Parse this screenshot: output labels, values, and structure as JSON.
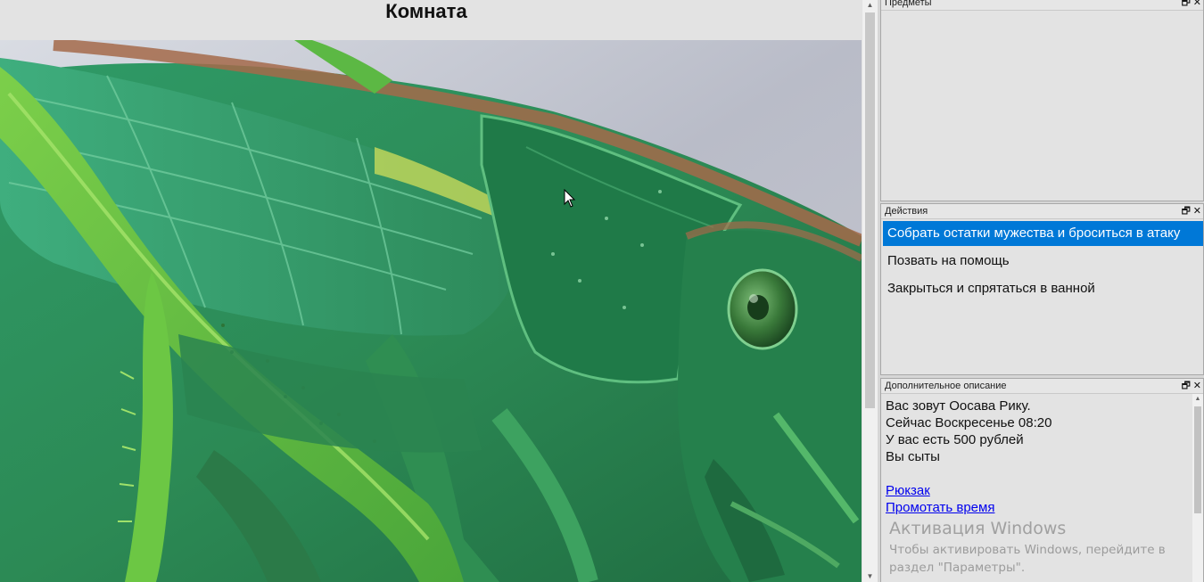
{
  "room": {
    "title": "Комната",
    "image_subject": "grasshopper-closeup"
  },
  "panels": {
    "items": {
      "title": "Предметы",
      "entries": []
    },
    "actions": {
      "title": "Действия",
      "entries": [
        {
          "label": "Собрать остатки мужества и броситься в атаку",
          "selected": true
        },
        {
          "label": "Позвать на помощь",
          "selected": false
        },
        {
          "label": "Закрыться и спрятаться в ванной",
          "selected": false
        }
      ]
    },
    "description": {
      "title": "Дополнительное описание",
      "lines": [
        "Вас зовут Оосава Рику.",
        "Сейчас Воскресенье 08:20",
        "У вас есть 500 рублей",
        "Вы сыты"
      ],
      "links": [
        "Рюкзак",
        "Промотать время"
      ]
    },
    "controls": {
      "restore_glyph": "🗗",
      "close_glyph": "✕"
    }
  },
  "watermark": {
    "title": "Активация Windows",
    "line1": "Чтобы активировать Windows, перейдите в",
    "line2": "раздел \"Параметры\"."
  },
  "colors": {
    "selection": "#0078d7",
    "link": "#0000ee",
    "panel_bg": "#e3e3e3"
  }
}
